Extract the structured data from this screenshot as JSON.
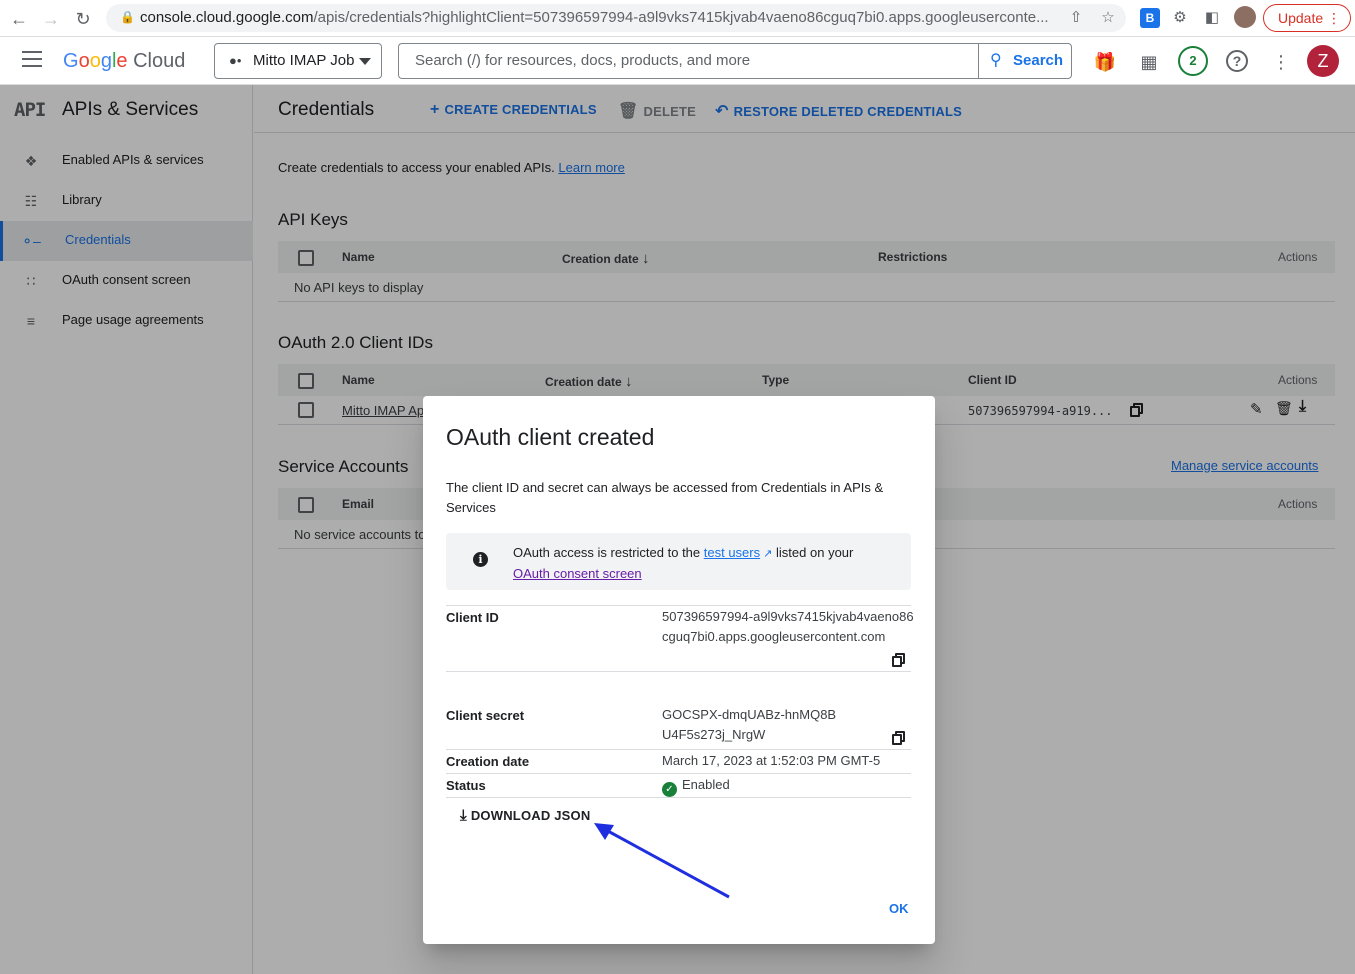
{
  "browser": {
    "url_host": "console.cloud.google.com",
    "url_rest": "/apis/credentials?highlightClient=507396597994-a9l9vks7415kjvab4vaeno86cguq7bi0.apps.googleuserconte...",
    "update_label": "Update"
  },
  "header": {
    "logo_rest": "Cloud",
    "project": "Mitto IMAP Job",
    "search_placeholder": "Search (/) for resources, docs, products, and more",
    "search_button": "Search",
    "notifications_count": "2",
    "avatar_letter": "Z"
  },
  "sidebar": {
    "api_mark": "API",
    "title": "APIs & Services",
    "items": [
      {
        "label": "Enabled APIs & services",
        "icon": "diamond-dots-icon"
      },
      {
        "label": "Library",
        "icon": "library-icon"
      },
      {
        "label": "Credentials",
        "icon": "key-icon"
      },
      {
        "label": "OAuth consent screen",
        "icon": "consent-icon"
      },
      {
        "label": "Page usage agreements",
        "icon": "settings-list-icon"
      }
    ]
  },
  "main": {
    "title": "Credentials",
    "actions": {
      "create": "CREATE CREDENTIALS",
      "delete": "DELETE",
      "restore": "RESTORE DELETED CREDENTIALS"
    },
    "intro": "Create credentials to access your enabled APIs.",
    "learn_more": "Learn more",
    "api_keys": {
      "title": "API Keys",
      "columns": {
        "name": "Name",
        "created": "Creation date",
        "restrictions": "Restrictions",
        "actions": "Actions"
      },
      "empty": "No API keys to display"
    },
    "oauth": {
      "title": "OAuth 2.0 Client IDs",
      "columns": {
        "name": "Name",
        "created": "Creation date",
        "type": "Type",
        "client_id": "Client ID",
        "actions": "Actions"
      },
      "row": {
        "name": "Mitto IMAP Ap",
        "client_id": "507396597994-a919..."
      }
    },
    "service": {
      "title": "Service Accounts",
      "manage": "Manage service accounts",
      "columns": {
        "email": "Email",
        "actions": "Actions"
      },
      "empty": "No service accounts to"
    }
  },
  "dialog": {
    "title": "OAuth client created",
    "text": "The client ID and secret can always be accessed from Credentials in APIs & Services",
    "info_prefix": "OAuth access is restricted to the",
    "info_link": "test users",
    "info_mid": "listed on your",
    "info_link2": "OAuth consent screen",
    "client_id_label": "Client ID",
    "client_id_value": "507396597994-a9l9vks7415kjvab4vaeno86cguq7bi0.apps.googleusercontent.com",
    "secret_label": "Client secret",
    "secret_value": "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",
    "date_label": "Creation date",
    "date_value": "March 17, 2023 at 1:52:03 PM GMT-5",
    "status_label": "Status",
    "status_value": "Enabled",
    "download": "DOWNLOAD JSON",
    "ok": "OK"
  },
  "colors": {
    "accent": "#1a73e8",
    "annotation_arrow": "#1f2fe0",
    "status_ok": "#188038",
    "avatar": "#b3223b"
  }
}
